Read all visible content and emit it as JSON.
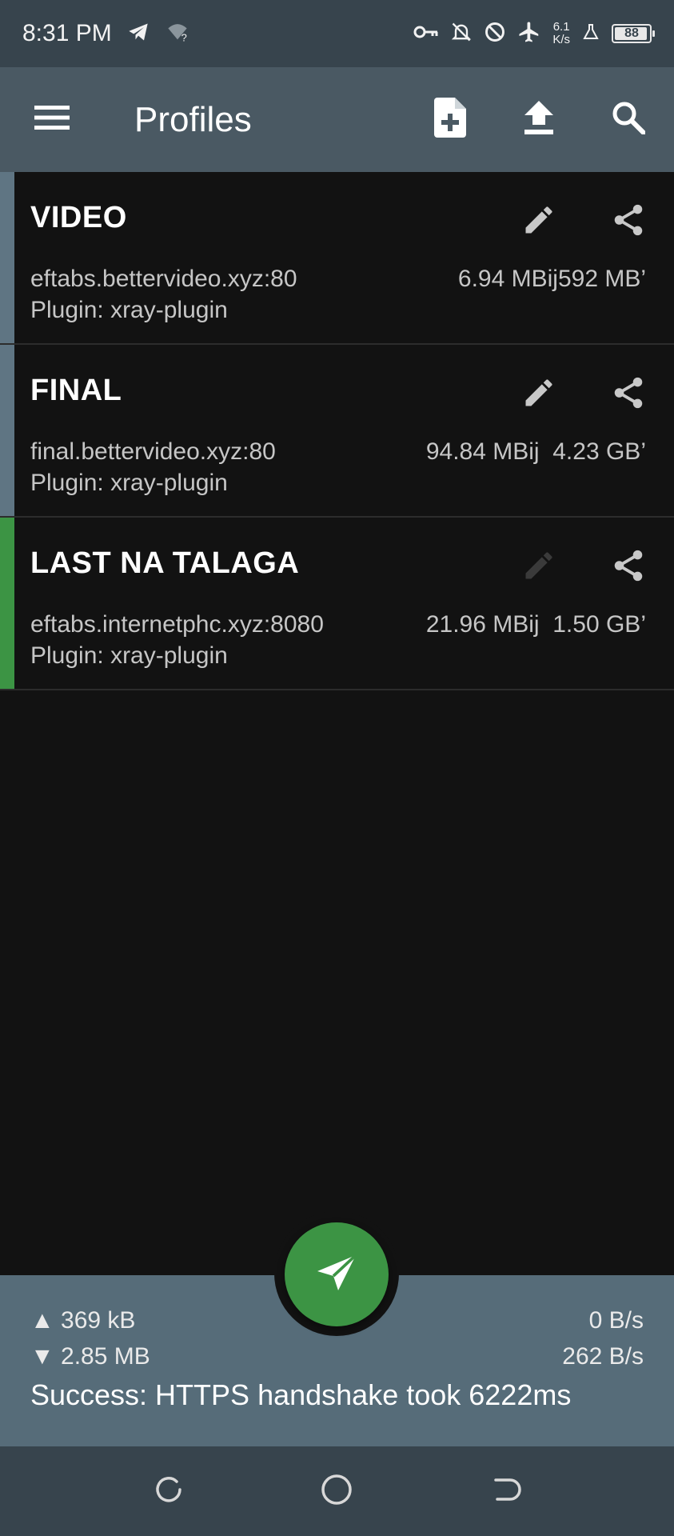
{
  "status_bar": {
    "time": "8:31 PM",
    "net_speed_value": "6.1",
    "net_speed_unit": "K/s",
    "battery": "88",
    "icons": [
      "telegram-icon",
      "wifi-question-icon",
      "vpn-key-icon",
      "bell-off-icon",
      "do-not-disturb-icon",
      "airplane-icon",
      "flask-icon",
      "battery-icon"
    ]
  },
  "toolbar": {
    "title": "Profiles",
    "icons": [
      "menu-icon",
      "add-file-icon",
      "upload-icon",
      "search-icon"
    ]
  },
  "profiles": [
    {
      "name": "VIDEO",
      "server": "eftabs.bettervideo.xyz:80",
      "plugin": "Plugin: xray-plugin",
      "traffic": "6.94 MBij592 MB’",
      "active": false,
      "edit_enabled": true
    },
    {
      "name": "FINAL",
      "server": "final.bettervideo.xyz:80",
      "plugin": "Plugin: xray-plugin",
      "traffic": "94.84 MBij  4.23 GB’",
      "active": false,
      "edit_enabled": true
    },
    {
      "name": "LAST NA TALAGA",
      "server": "eftabs.internetphc.xyz:8080",
      "plugin": "Plugin: xray-plugin",
      "traffic": "21.96 MBij  1.50 GB’",
      "active": true,
      "edit_enabled": false
    }
  ],
  "stats": {
    "tx_total": "▲ 369 kB",
    "rx_total": "▼ 2.85 MB",
    "tx_rate": "0 B/s",
    "rx_rate": "262 B/s",
    "message": "Success: HTTPS handshake took 6222ms"
  },
  "fab": {
    "icon": "paper-plane-icon"
  },
  "navbar": {
    "icons": [
      "recent-apps-icon",
      "home-icon",
      "back-icon"
    ]
  },
  "colors": {
    "status_bar": "#37444d",
    "toolbar": "#4a5963",
    "background": "#121212",
    "accent_inactive": "#5f7583",
    "accent_active": "#3c9444",
    "stats_panel": "#566c79",
    "fab": "#3c9444"
  }
}
